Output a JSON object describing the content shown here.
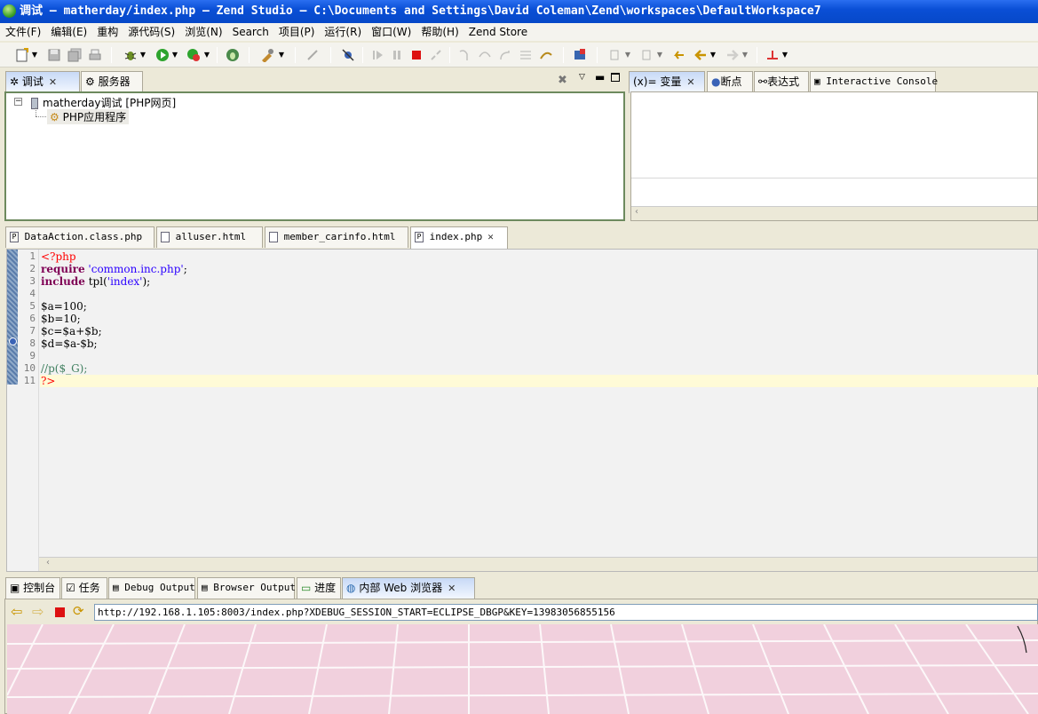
{
  "window": {
    "title": "调试 — matherday/index.php — Zend Studio — C:\\Documents and Settings\\David Coleman\\Zend\\workspaces\\DefaultWorkspace7"
  },
  "menu": [
    "文件(F)",
    "编辑(E)",
    "重构",
    "源代码(S)",
    "浏览(N)",
    "Search",
    "项目(P)",
    "运行(R)",
    "窗口(W)",
    "帮助(H)",
    "Zend Store"
  ],
  "debug_view": {
    "tabs": [
      {
        "label": "调试",
        "active": true
      },
      {
        "label": "服务器",
        "active": false
      }
    ],
    "tree": {
      "launch": "matherday调试 [PHP网页]",
      "child": "PHP应用程序"
    }
  },
  "variables_view": {
    "tabs": [
      {
        "label": "(x)= 变量",
        "active": true
      },
      {
        "label": "断点"
      },
      {
        "label": "表达式"
      },
      {
        "label": "Interactive Console"
      }
    ]
  },
  "editor": {
    "tabs": [
      {
        "label": "DataAction.class.php",
        "active": false
      },
      {
        "label": "alluser.html",
        "active": false
      },
      {
        "label": "member_carinfo.html",
        "active": false
      },
      {
        "label": "index.php",
        "active": true
      }
    ],
    "line_numbers": [
      "1",
      "2",
      "3",
      "4",
      "5",
      "6",
      "7",
      "8",
      "9",
      "10",
      "11"
    ],
    "breakpoint_line": 8,
    "current_line": 11
  },
  "bottom_view": {
    "tabs": [
      {
        "label": "控制台"
      },
      {
        "label": "任务"
      },
      {
        "label": "Debug Output"
      },
      {
        "label": "Browser Output"
      },
      {
        "label": "进度"
      },
      {
        "label": "内部 Web 浏览器",
        "active": true
      }
    ],
    "url": "http://192.168.1.105:8003/index.php?XDEBUG_SESSION_START=ECLIPSE_DBGP&KEY=13983056855156"
  },
  "colors": {
    "titlebar": "#0a4fd6",
    "keyword": "#7f0055",
    "string": "#2a00ff",
    "comment": "#3f7f5f",
    "php_tag": "#ff0000",
    "browser_bg": "#f1d0dd"
  }
}
